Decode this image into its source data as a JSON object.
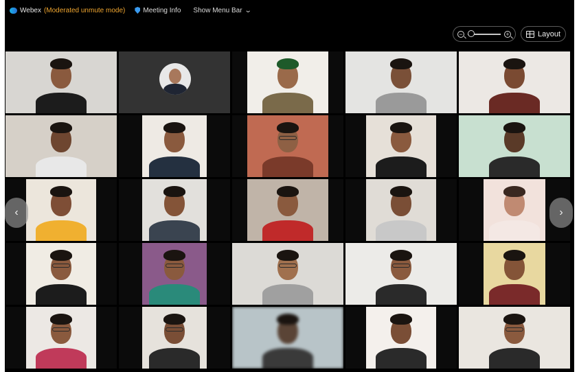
{
  "titlebar": {
    "app_name": "Webex",
    "mode": "(Moderated unmute mode)",
    "meeting_info": "Meeting Info",
    "show_menu_bar": "Show Menu Bar"
  },
  "controls": {
    "zoom_out": "−",
    "zoom_in": "+",
    "zoom_level": 0,
    "layout_label": "Layout"
  },
  "navigation": {
    "prev": "‹",
    "next": "›"
  },
  "colors": {
    "mode_text": "#f0a630",
    "window_bg": "#000000",
    "accent": "#2c6fd6"
  },
  "participants": [
    {
      "bg": "#d8d6d2",
      "skin": "#8a5a3e",
      "shirt": "#1c1c1c",
      "hair": "#1a1410",
      "inset": false,
      "glasses": false
    },
    {
      "bg": "#333333",
      "skin": "#a8785c",
      "shirt": "#1f2533",
      "hair": "#1a1410",
      "inset": false,
      "glasses": false,
      "avatar": true
    },
    {
      "bg": "#f1eee9",
      "skin": "#9a6a4a",
      "shirt": "#7a6a4a",
      "hair": "#1e5a2a",
      "inset": true,
      "glasses": false
    },
    {
      "bg": "#e4e4e2",
      "skin": "#7a5038",
      "shirt": "#9a9a9a",
      "hair": "#1a1410",
      "inset": false,
      "glasses": false
    },
    {
      "bg": "#ece8e4",
      "skin": "#7a4a32",
      "shirt": "#6a2a24",
      "hair": "#1a1410",
      "inset": false,
      "glasses": false
    },
    {
      "bg": "#d6d0c8",
      "skin": "#6e4630",
      "shirt": "#e8e8e8",
      "hair": "#1a1410",
      "inset": false,
      "glasses": false
    },
    {
      "bg": "#eeeae4",
      "skin": "#8a5a3e",
      "shirt": "#243040",
      "hair": "#1a1410",
      "inset": true,
      "glasses": false
    },
    {
      "bg": "#c06a52",
      "skin": "#8e6044",
      "shirt": "#7a3a2a",
      "hair": "#1a1410",
      "inset": true,
      "glasses": true
    },
    {
      "bg": "#e6e0d8",
      "skin": "#8a5a3e",
      "shirt": "#1c1c1c",
      "hair": "#1a1410",
      "inset": true,
      "glasses": false
    },
    {
      "bg": "#c8e0d0",
      "skin": "#5a3a28",
      "shirt": "#2a2a2a",
      "hair": "#1a1410",
      "inset": false,
      "glasses": false
    },
    {
      "bg": "#ece6dc",
      "skin": "#7e4e36",
      "shirt": "#f0b030",
      "hair": "#1a1410",
      "inset": true,
      "glasses": false
    },
    {
      "bg": "#e2e0dc",
      "skin": "#845438",
      "shirt": "#3a4450",
      "hair": "#1a1410",
      "inset": true,
      "glasses": false
    },
    {
      "bg": "#c0b4a8",
      "skin": "#8a5a3e",
      "shirt": "#c02a2a",
      "hair": "#1a1410",
      "inset": true,
      "glasses": false
    },
    {
      "bg": "#e0dcd6",
      "skin": "#7a4e36",
      "shirt": "#c8c8c8",
      "hair": "#1a1410",
      "inset": true,
      "glasses": false
    },
    {
      "bg": "#f2e2dc",
      "skin": "#c08a72",
      "shirt": "#f4e8e4",
      "hair": "#3a2820",
      "inset": true,
      "glasses": false
    },
    {
      "bg": "#f0ece4",
      "skin": "#8a5a3e",
      "shirt": "#1c1c1c",
      "hair": "#1a1410",
      "inset": true,
      "glasses": true
    },
    {
      "bg": "#8a5a8a",
      "skin": "#8a5a3e",
      "shirt": "#2a8a7a",
      "hair": "#1a1410",
      "inset": true,
      "glasses": true
    },
    {
      "bg": "#dcdad6",
      "skin": "#a0704e",
      "shirt": "#a0a0a0",
      "hair": "#1a1410",
      "inset": false,
      "glasses": true
    },
    {
      "bg": "#ecebe8",
      "skin": "#8a5a3e",
      "shirt": "#2a2a2a",
      "hair": "#1a1410",
      "inset": false,
      "glasses": true
    },
    {
      "bg": "#e8d8a0",
      "skin": "#845438",
      "shirt": "#7a2a2a",
      "hair": "#1a1410",
      "inset": true,
      "glasses": false
    },
    {
      "bg": "#ece8e4",
      "skin": "#8a5a3e",
      "shirt": "#c03a5a",
      "hair": "#1a1410",
      "inset": true,
      "glasses": true
    },
    {
      "bg": "#e6e2dc",
      "skin": "#7a4e36",
      "shirt": "#2a2a2a",
      "hair": "#1a1410",
      "inset": true,
      "glasses": true
    },
    {
      "bg": "#b8c4c8",
      "skin": "#5a4436",
      "shirt": "#3a3a3a",
      "hair": "#1a1410",
      "inset": false,
      "glasses": false,
      "blur": true
    },
    {
      "bg": "#f4f0ec",
      "skin": "#7a4e36",
      "shirt": "#2a2a2a",
      "hair": "#1a1410",
      "inset": true,
      "glasses": false
    },
    {
      "bg": "#eae6e0",
      "skin": "#8a5a3e",
      "shirt": "#2a2a2a",
      "hair": "#1a1410",
      "inset": false,
      "glasses": true
    }
  ]
}
